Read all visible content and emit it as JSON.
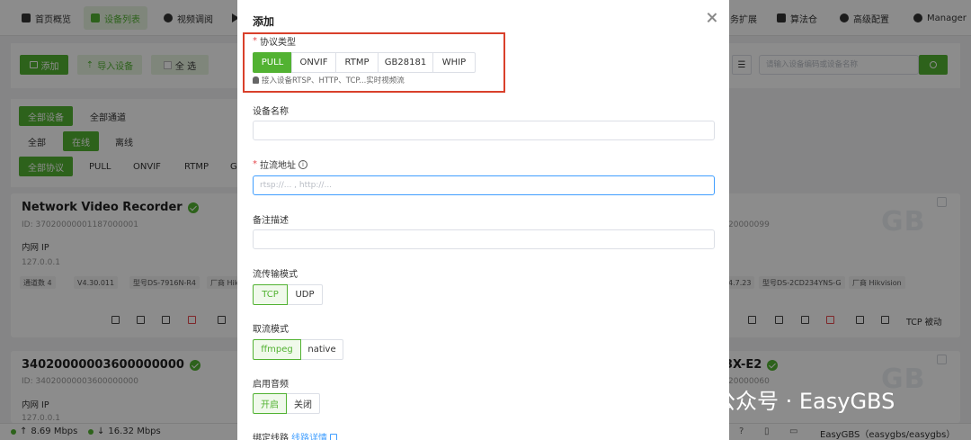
{
  "nav": {
    "items": [
      "首页概览",
      "设备列表",
      "视频调阅",
      "务扩展",
      "算法仓",
      "高级配置",
      "Manager"
    ]
  },
  "toolbar": {
    "add": "添加",
    "import": "导入设备",
    "select_all": "全 选",
    "search_placeholder": "请输入设备编码或设备名称"
  },
  "filters": {
    "group": [
      "全部设备",
      "全部通道"
    ],
    "status": [
      "全部",
      "在线",
      "离线"
    ],
    "protocols": [
      "全部协议",
      "PULL",
      "ONVIF",
      "RTMP",
      "G"
    ]
  },
  "cards": {
    "c1": {
      "title": "Network Video Recorder",
      "id": "ID: 37020000001187000001",
      "lan_label": "内网 IP",
      "lan_ip": "127.0.0.1",
      "channels": "通道数 4",
      "version": "V4.30.011",
      "model": "型号DS-7916N-R4",
      "vendor": "厂商 Hik"
    },
    "c2": {
      "id_tail": "20000099",
      "version_tail": "4.7.23",
      "model": "型号DS-2CD234YNS-G",
      "vendor": "厂商 Hikvision",
      "mode": "TCP 被动"
    },
    "c3": {
      "title": "34020000003600000000",
      "id": "ID: 34020000003600000000",
      "lan_label": "内网 IP",
      "lan_ip": "127.0.0.1"
    },
    "c4": {
      "title_tail": "3X-E2",
      "id_tail": "20000060"
    },
    "gb_mark": "GB"
  },
  "status": {
    "up": "8.69 Mbps",
    "down": "16.32 Mbps",
    "brand": "EasyGBS（easygbs/easygbs）"
  },
  "watermark": "公众号 · EasyGBS",
  "modal": {
    "title": "添加",
    "protocol_label": "协议类型",
    "protocols": [
      "PULL",
      "ONVIF",
      "RTMP",
      "GB28181",
      "WHIP"
    ],
    "protocol_selected": "PULL",
    "protocol_hint": "接入设备RTSP、HTTP、TCP...实时视频流",
    "name_label": "设备名称",
    "name_value": "",
    "url_label": "拉流地址",
    "url_placeholder": "rtsp://... , http://...",
    "desc_label": "备注描述",
    "desc_value": "",
    "transport_label": "流传输模式",
    "transport_options": [
      "TCP",
      "UDP"
    ],
    "transport_selected": "TCP",
    "pull_mode_label": "取流模式",
    "pull_mode_options": [
      "ffmpeg",
      "native"
    ],
    "pull_mode_selected": "ffmpeg",
    "audio_label": "启用音频",
    "audio_options": [
      "开启",
      "关闭"
    ],
    "audio_selected": "开启",
    "route_label": "绑定线路",
    "route_link": "线路详情"
  },
  "colors": {
    "accent": "#52b232",
    "accent_soft": "#e8f5e1",
    "highlight_box": "#d9402b",
    "link": "#409eff"
  }
}
